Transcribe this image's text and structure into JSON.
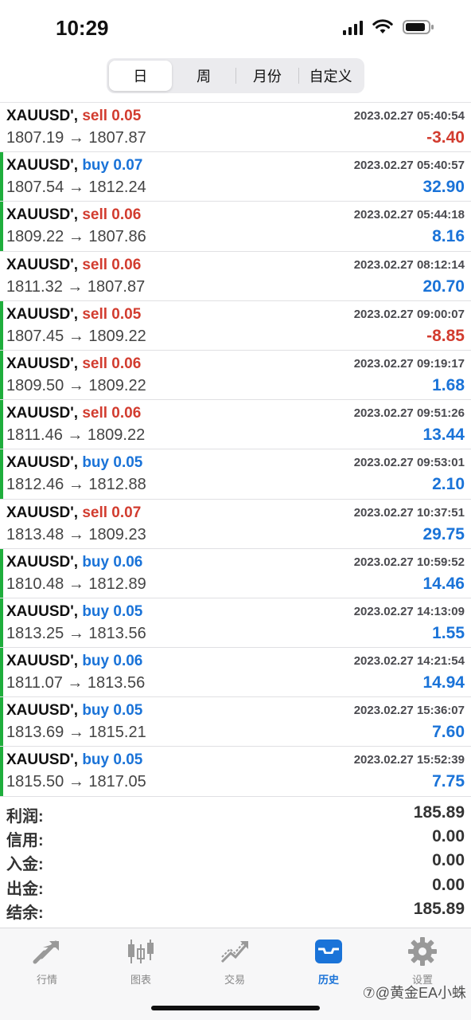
{
  "status_bar": {
    "time": "10:29"
  },
  "segmented": {
    "options": [
      "日",
      "周",
      "月份",
      "自定义"
    ],
    "active_index": 0
  },
  "deals": [
    {
      "symbol": "XAUUSD',",
      "side": "sell",
      "lots": "0.05",
      "time": "2023.02.27 05:40:54",
      "prices": "1807.19 → 1807.87",
      "profit": "-3.40",
      "marker": false
    },
    {
      "symbol": "XAUUSD',",
      "side": "buy",
      "lots": "0.07",
      "time": "2023.02.27 05:40:57",
      "prices": "1807.54 → 1812.24",
      "profit": "32.90",
      "marker": true
    },
    {
      "symbol": "XAUUSD',",
      "side": "sell",
      "lots": "0.06",
      "time": "2023.02.27 05:44:18",
      "prices": "1809.22 → 1807.86",
      "profit": "8.16",
      "marker": true
    },
    {
      "symbol": "XAUUSD',",
      "side": "sell",
      "lots": "0.06",
      "time": "2023.02.27 08:12:14",
      "prices": "1811.32 → 1807.87",
      "profit": "20.70",
      "marker": false
    },
    {
      "symbol": "XAUUSD',",
      "side": "sell",
      "lots": "0.05",
      "time": "2023.02.27 09:00:07",
      "prices": "1807.45 → 1809.22",
      "profit": "-8.85",
      "marker": true
    },
    {
      "symbol": "XAUUSD',",
      "side": "sell",
      "lots": "0.06",
      "time": "2023.02.27 09:19:17",
      "prices": "1809.50 → 1809.22",
      "profit": "1.68",
      "marker": true
    },
    {
      "symbol": "XAUUSD',",
      "side": "sell",
      "lots": "0.06",
      "time": "2023.02.27 09:51:26",
      "prices": "1811.46 → 1809.22",
      "profit": "13.44",
      "marker": true
    },
    {
      "symbol": "XAUUSD',",
      "side": "buy",
      "lots": "0.05",
      "time": "2023.02.27 09:53:01",
      "prices": "1812.46 → 1812.88",
      "profit": "2.10",
      "marker": true
    },
    {
      "symbol": "XAUUSD',",
      "side": "sell",
      "lots": "0.07",
      "time": "2023.02.27 10:37:51",
      "prices": "1813.48 → 1809.23",
      "profit": "29.75",
      "marker": false
    },
    {
      "symbol": "XAUUSD',",
      "side": "buy",
      "lots": "0.06",
      "time": "2023.02.27 10:59:52",
      "prices": "1810.48 → 1812.89",
      "profit": "14.46",
      "marker": true
    },
    {
      "symbol": "XAUUSD',",
      "side": "buy",
      "lots": "0.05",
      "time": "2023.02.27 14:13:09",
      "prices": "1813.25 → 1813.56",
      "profit": "1.55",
      "marker": true
    },
    {
      "symbol": "XAUUSD',",
      "side": "buy",
      "lots": "0.06",
      "time": "2023.02.27 14:21:54",
      "prices": "1811.07 → 1813.56",
      "profit": "14.94",
      "marker": true
    },
    {
      "symbol": "XAUUSD',",
      "side": "buy",
      "lots": "0.05",
      "time": "2023.02.27 15:36:07",
      "prices": "1813.69 → 1815.21",
      "profit": "7.60",
      "marker": true
    },
    {
      "symbol": "XAUUSD',",
      "side": "buy",
      "lots": "0.05",
      "time": "2023.02.27 15:52:39",
      "prices": "1815.50 → 1817.05",
      "profit": "7.75",
      "marker": true
    }
  ],
  "summary": [
    {
      "label": "利润:",
      "value": "185.89"
    },
    {
      "label": "信用:",
      "value": "0.00"
    },
    {
      "label": "入金:",
      "value": "0.00"
    },
    {
      "label": "出金:",
      "value": "0.00"
    },
    {
      "label": "结余:",
      "value": "185.89"
    }
  ],
  "tabbar": {
    "items": [
      {
        "label": "行情",
        "icon": "quotes-arrows-icon"
      },
      {
        "label": "图表",
        "icon": "candlestick-chart-icon"
      },
      {
        "label": "交易",
        "icon": "trade-trend-icon"
      },
      {
        "label": "历史",
        "icon": "history-inbox-icon"
      },
      {
        "label": "设置",
        "icon": "gear-icon"
      }
    ],
    "active_index": 3
  },
  "watermark": "⑦@黄金EA小蛛",
  "colors": {
    "sell": "#d23c2f",
    "buy": "#1a73d8",
    "negative": "#d23c2f",
    "positive": "#1a73d8",
    "marker": "#1fae3c",
    "active_tab": "#1a73d8",
    "inactive_tab": "#888888"
  }
}
